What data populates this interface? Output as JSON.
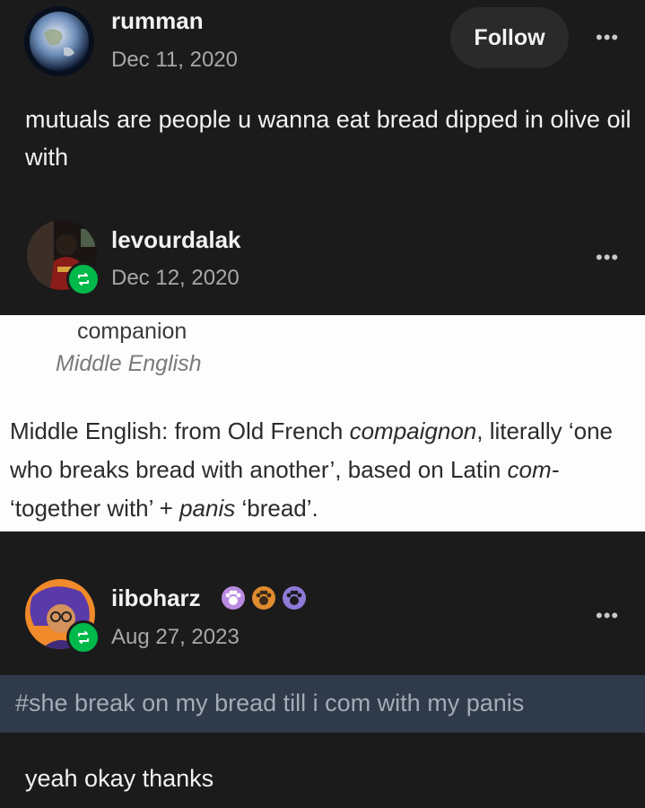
{
  "post1": {
    "username": "rumman",
    "date": "Dec 11, 2020",
    "follow_label": "Follow",
    "more_label": "•••",
    "text": "mutuals are people u wanna eat bread dipped in olive oil with"
  },
  "post2": {
    "username": "levourdalak",
    "date": "Dec 12, 2020",
    "more_label": "•••",
    "image": {
      "headword": "companion",
      "origin_label": "Middle English",
      "etymology": {
        "p1": "Middle English: from Old French ",
        "i1": "compaignon",
        "p2": ", literally ‘one who breaks bread with another’, based on Latin ",
        "i2": "com-",
        "p3": " ‘together with’ + ",
        "i3": "panis",
        "p4": " ‘bread’."
      }
    }
  },
  "post3": {
    "username": "iiboharz",
    "date": "Aug 27, 2023",
    "more_label": "•••",
    "tag_text": "#she break on my bread till i com with my panis",
    "text": "yeah okay thanks",
    "badge_colors": [
      "#b98be0",
      "#e08c2e",
      "#8f7ad9"
    ]
  },
  "colors": {
    "background": "#1b1b1c",
    "reblog_green": "#00b94b",
    "tag_bar": "#2f3a4a"
  }
}
